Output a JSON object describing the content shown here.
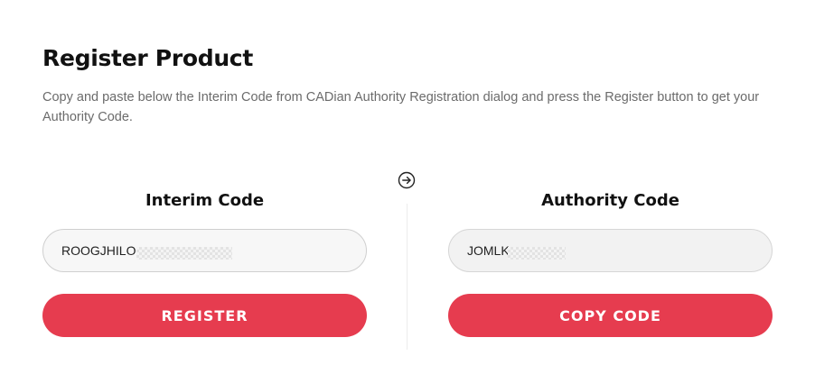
{
  "page": {
    "title": "Register Product",
    "description": "Copy and paste below the Interim Code from CADian Authority Registration dialog and press the Register button to get your Authority Code."
  },
  "icons": {
    "arrow": "arrow-right-circle-icon"
  },
  "interim": {
    "heading": "Interim Code",
    "value": "ROOGJHILO",
    "button_label": "REGISTER"
  },
  "authority": {
    "heading": "Authority Code",
    "value": "JOMLK",
    "button_label": "COPY CODE"
  },
  "colors": {
    "accent": "#e63c4f",
    "text": "#111111",
    "muted_text": "#6b6b6b",
    "field_border": "#cfcfcf"
  }
}
